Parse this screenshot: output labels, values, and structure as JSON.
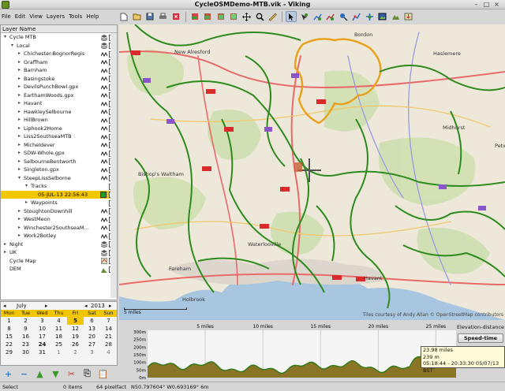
{
  "window": {
    "title": "CycleOSMDemo-MTB.vik - Viking",
    "controls": [
      "–",
      "□",
      "×"
    ]
  },
  "menu": [
    "File",
    "Edit",
    "View",
    "Layers",
    "Tools",
    "Help"
  ],
  "toolbar": {
    "icons": [
      "new-icon",
      "open-icon",
      "save-icon",
      "print-icon",
      "exit-icon",
      "map-mode-1-icon",
      "map-mode-2-icon",
      "map-mode-3-icon",
      "map-mode-4-icon",
      "pan-icon",
      "zoom-icon",
      "ruler-icon",
      "select-icon",
      "create-waypoint-icon",
      "create-track-icon",
      "create-route-icon",
      "edit-waypoint-icon",
      "edit-trackpoint-icon",
      "route-finder-icon",
      "show-picture-icon",
      "dem-download-icon",
      "map-download-icon"
    ]
  },
  "layers_panel": {
    "header": "Layer Name",
    "rows": [
      {
        "label": "Cycle MTB",
        "level": 1,
        "expander": "▾",
        "icon": "aggregate",
        "checked": true
      },
      {
        "label": "Local",
        "level": 2,
        "expander": "▾",
        "icon": "aggregate",
        "checked": true
      },
      {
        "label": "Chichester-BognorRegis",
        "level": 3,
        "expander": "▸",
        "icon": "trw",
        "checked": true
      },
      {
        "label": "Graffham",
        "level": 3,
        "expander": "▸",
        "icon": "trw",
        "checked": true
      },
      {
        "label": "Barnham",
        "level": 3,
        "expander": "▸",
        "icon": "trw",
        "checked": true
      },
      {
        "label": "Basingstoke",
        "level": 3,
        "expander": "▸",
        "icon": "trw",
        "checked": true
      },
      {
        "label": "DevilsPunchBowl.gpx",
        "level": 3,
        "expander": "▸",
        "icon": "trw",
        "checked": true
      },
      {
        "label": "EarthamWoods.gpx",
        "level": 3,
        "expander": "▸",
        "icon": "trw",
        "checked": true
      },
      {
        "label": "Havant",
        "level": 3,
        "expander": "▸",
        "icon": "trw",
        "checked": true
      },
      {
        "label": "HawkleySelbourne",
        "level": 3,
        "expander": "▸",
        "icon": "trw",
        "checked": true
      },
      {
        "label": "HillBrown",
        "level": 3,
        "expander": "▸",
        "icon": "trw",
        "checked": true
      },
      {
        "label": "Liphook2Home",
        "level": 3,
        "expander": "▸",
        "icon": "trw",
        "checked": true
      },
      {
        "label": "Liss2SouthseaMTB",
        "level": 3,
        "expander": "▸",
        "icon": "trw",
        "checked": true
      },
      {
        "label": "Micheldever",
        "level": 3,
        "expander": "▸",
        "icon": "trw",
        "checked": true
      },
      {
        "label": "SDW-Whole.gpx",
        "level": 3,
        "expander": "▸",
        "icon": "trw",
        "checked": true
      },
      {
        "label": "SelbourneBentworth",
        "level": 3,
        "expander": "▸",
        "icon": "trw",
        "checked": true
      },
      {
        "label": "Singleton.gpx",
        "level": 3,
        "expander": "▸",
        "icon": "trw",
        "checked": true
      },
      {
        "label": "SteepLissSelborne",
        "level": 3,
        "expander": "▾",
        "icon": "trw",
        "checked": true
      },
      {
        "label": "Tracks",
        "level": 4,
        "expander": "▾",
        "icon": "",
        "checked": true
      },
      {
        "label": "05-JUL-13 22:56:43",
        "level": 5,
        "expander": "",
        "icon": "swatch",
        "checked": true,
        "selected": true
      },
      {
        "label": "Waypoints",
        "level": 4,
        "expander": "▸",
        "icon": "",
        "checked": false
      },
      {
        "label": "StoughtonDownhill",
        "level": 3,
        "expander": "▸",
        "icon": "trw",
        "checked": true
      },
      {
        "label": "WestMeon",
        "level": 3,
        "expander": "▸",
        "icon": "trw",
        "checked": true
      },
      {
        "label": "Winchester2SouthseaM…",
        "level": 3,
        "expander": "▸",
        "icon": "trw",
        "checked": true
      },
      {
        "label": "Work2Botley",
        "level": 3,
        "expander": "▸",
        "icon": "trw",
        "checked": true
      },
      {
        "label": "Night",
        "level": 1,
        "expander": "▸",
        "icon": "aggregate",
        "checked": true
      },
      {
        "label": "UK",
        "level": 1,
        "expander": "▸",
        "icon": "aggregate",
        "checked": true
      },
      {
        "label": "Cycle Map",
        "level": 1,
        "expander": "",
        "icon": "map",
        "checked": true
      },
      {
        "label": "DEM",
        "level": 1,
        "expander": "",
        "icon": "dem",
        "checked": true
      }
    ]
  },
  "calendar": {
    "prev": "◂",
    "month": "July",
    "next": "▸",
    "year_prev": "◂",
    "year": "2013",
    "year_next": "▸",
    "weekdays": [
      "Mon",
      "Tue",
      "Wed",
      "Thu",
      "Fri",
      "Sat",
      "Sun"
    ],
    "days": [
      {
        "d": "1",
        "t": ""
      },
      {
        "d": "2",
        "t": ""
      },
      {
        "d": "3",
        "t": ""
      },
      {
        "d": "4",
        "t": ""
      },
      {
        "d": "5",
        "t": "today"
      },
      {
        "d": "6",
        "t": ""
      },
      {
        "d": "7",
        "t": ""
      },
      {
        "d": "8",
        "t": ""
      },
      {
        "d": "9",
        "t": ""
      },
      {
        "d": "10",
        "t": ""
      },
      {
        "d": "11",
        "t": ""
      },
      {
        "d": "12",
        "t": ""
      },
      {
        "d": "13",
        "t": ""
      },
      {
        "d": "14",
        "t": ""
      },
      {
        "d": "15",
        "t": ""
      },
      {
        "d": "16",
        "t": ""
      },
      {
        "d": "17",
        "t": ""
      },
      {
        "d": "18",
        "t": ""
      },
      {
        "d": "19",
        "t": ""
      },
      {
        "d": "20",
        "t": ""
      },
      {
        "d": "21",
        "t": ""
      },
      {
        "d": "22",
        "t": ""
      },
      {
        "d": "23",
        "t": ""
      },
      {
        "d": "24",
        "t": "b"
      },
      {
        "d": "25",
        "t": ""
      },
      {
        "d": "26",
        "t": ""
      },
      {
        "d": "27",
        "t": ""
      },
      {
        "d": "28",
        "t": ""
      },
      {
        "d": "29",
        "t": ""
      },
      {
        "d": "30",
        "t": ""
      },
      {
        "d": "31",
        "t": ""
      },
      {
        "d": "1",
        "t": "other"
      },
      {
        "d": "2",
        "t": "other"
      },
      {
        "d": "3",
        "t": "other"
      },
      {
        "d": "4",
        "t": "other"
      }
    ]
  },
  "layer_tools": [
    {
      "name": "add-layer-icon",
      "glyph": "+",
      "color": "#2a7fd4"
    },
    {
      "name": "remove-layer-icon",
      "glyph": "−",
      "color": "#2a7fd4"
    },
    {
      "name": "move-up-icon",
      "glyph": "▲",
      "color": "#3a9b2a"
    },
    {
      "name": "move-down-icon",
      "glyph": "▼",
      "color": "#3a9b2a"
    },
    {
      "name": "cut-icon",
      "glyph": "✂",
      "color": "#c23232"
    },
    {
      "name": "copy-icon",
      "glyph": "⎘",
      "color": "#555555"
    },
    {
      "name": "paste-icon",
      "glyph": "📋",
      "color": "#555555"
    }
  ],
  "statusbar": {
    "tool": "Select",
    "items": "0 items",
    "zoom": "64 pixelfact",
    "coords": "N50.797604° W0.693169° 6m"
  },
  "map": {
    "places": [
      "Bordon",
      "Haslemere",
      "New Alresford",
      "Bishop's Waltham",
      "Midhurst",
      "Petw",
      "Waterlooville",
      "Fareham",
      "Holbrook",
      "Havant"
    ],
    "attribution": "Tiles courtesy of Andy Allan © OpenStreetMap contributors",
    "scale": "5 miles"
  },
  "elevation": {
    "x_ticks": [
      "5 miles",
      "10 miles",
      "15 miles",
      "20 miles",
      "25 miles"
    ],
    "y_ticks": [
      "300m",
      "250m",
      "200m",
      "150m",
      "100m",
      "50m",
      "0m"
    ],
    "mode_title": "Elevation-distance",
    "speed_button": "Speed-time",
    "tooltip": {
      "distance": "23.98 miles",
      "altitude": "239 m",
      "time": "05:18:44 - 20:33:30 05/07/13 BST"
    },
    "colors": {
      "profile_fill": "#8a7426",
      "profile_line": "#2f7a18"
    }
  }
}
